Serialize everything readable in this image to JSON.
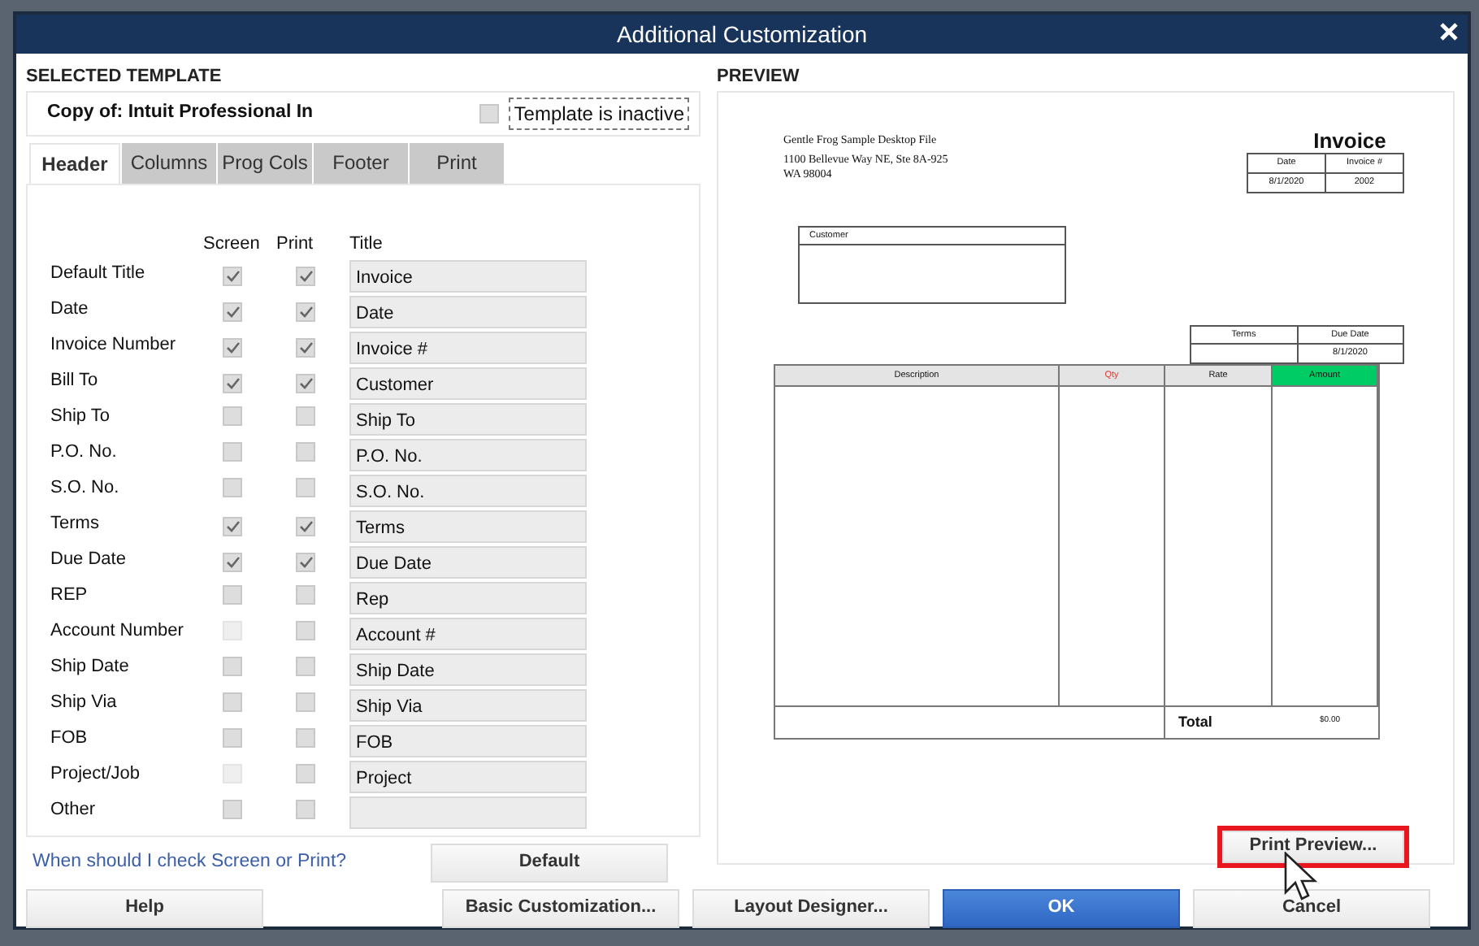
{
  "window": {
    "title": "Additional Customization"
  },
  "selected_template": {
    "heading": "SELECTED TEMPLATE",
    "name": "Copy of: Intuit Professional In",
    "inactive": {
      "label": "Template is inactive",
      "checked": false
    }
  },
  "tabs": [
    {
      "label": "Header",
      "selected": true
    },
    {
      "label": "Columns",
      "selected": false
    },
    {
      "label": "Prog Cols",
      "selected": false
    },
    {
      "label": "Footer",
      "selected": false
    },
    {
      "label": "Print",
      "selected": false
    }
  ],
  "columns": [
    "Screen",
    "Print",
    "Title"
  ],
  "fields": [
    {
      "label": "Default Title",
      "screen": {
        "checked": true,
        "disabled": false
      },
      "print": {
        "checked": true
      },
      "title": "Invoice"
    },
    {
      "label": "Date",
      "screen": {
        "checked": true,
        "disabled": false
      },
      "print": {
        "checked": true
      },
      "title": "Date"
    },
    {
      "label": "Invoice Number",
      "screen": {
        "checked": true,
        "disabled": false
      },
      "print": {
        "checked": true
      },
      "title": "Invoice #"
    },
    {
      "label": "Bill To",
      "screen": {
        "checked": true,
        "disabled": false
      },
      "print": {
        "checked": true
      },
      "title": "Customer"
    },
    {
      "label": "Ship To",
      "screen": {
        "checked": false,
        "disabled": false
      },
      "print": {
        "checked": false
      },
      "title": "Ship To"
    },
    {
      "label": "P.O. No.",
      "screen": {
        "checked": false,
        "disabled": false
      },
      "print": {
        "checked": false
      },
      "title": "P.O. No."
    },
    {
      "label": "S.O. No.",
      "screen": {
        "checked": false,
        "disabled": false
      },
      "print": {
        "checked": false
      },
      "title": "S.O. No."
    },
    {
      "label": "Terms",
      "screen": {
        "checked": true,
        "disabled": false
      },
      "print": {
        "checked": true
      },
      "title": "Terms"
    },
    {
      "label": "Due Date",
      "screen": {
        "checked": true,
        "disabled": false
      },
      "print": {
        "checked": true
      },
      "title": "Due Date"
    },
    {
      "label": "REP",
      "screen": {
        "checked": false,
        "disabled": false
      },
      "print": {
        "checked": false
      },
      "title": "Rep"
    },
    {
      "label": "Account Number",
      "screen": {
        "checked": false,
        "disabled": true
      },
      "print": {
        "checked": false
      },
      "title": "Account #"
    },
    {
      "label": "Ship Date",
      "screen": {
        "checked": false,
        "disabled": false
      },
      "print": {
        "checked": false
      },
      "title": "Ship Date"
    },
    {
      "label": "Ship Via",
      "screen": {
        "checked": false,
        "disabled": false
      },
      "print": {
        "checked": false
      },
      "title": "Ship Via"
    },
    {
      "label": "FOB",
      "screen": {
        "checked": false,
        "disabled": false
      },
      "print": {
        "checked": false
      },
      "title": "FOB"
    },
    {
      "label": "Project/Job",
      "screen": {
        "checked": false,
        "disabled": true
      },
      "print": {
        "checked": false
      },
      "title": "Project"
    },
    {
      "label": "Other",
      "screen": {
        "checked": false,
        "disabled": false
      },
      "print": {
        "checked": false
      }
    }
  ],
  "help_link": "When should I check Screen or Print?",
  "default_button": "Default",
  "preview": {
    "heading": "PREVIEW",
    "company": [
      "Gentle Frog Sample Desktop File",
      "1100 Bellevue Way NE, Ste 8A-925",
      "WA 98004"
    ],
    "doc_title": "Invoice",
    "header_table": {
      "columns": [
        "Date",
        "Invoice #"
      ],
      "values": [
        "8/1/2020",
        "2002"
      ]
    },
    "bill_box": "Customer",
    "terms_table": [
      {
        "label": "Terms"
      },
      {
        "label": "Due Date",
        "value": "8/1/2020"
      }
    ],
    "item_columns": [
      {
        "label": "Description",
        "kind": "plain"
      },
      {
        "label": "Qty",
        "kind": "tinted",
        "color": "#e53935"
      },
      {
        "label": "Rate",
        "kind": "plain"
      },
      {
        "label": "Amount",
        "kind": "filled",
        "color": "#00cc66"
      }
    ],
    "total_label": "Total",
    "total_value": "$0.00",
    "print_preview_button": {
      "label": "Print Preview...",
      "highlighted": true
    }
  },
  "buttons": [
    {
      "label": "Help",
      "kind": "plain"
    },
    {
      "label": "Basic Customization...",
      "kind": "plain"
    },
    {
      "label": "Layout Designer...",
      "kind": "plain"
    },
    {
      "label": "OK",
      "kind": "primary"
    },
    {
      "label": "Cancel",
      "kind": "plain"
    }
  ]
}
